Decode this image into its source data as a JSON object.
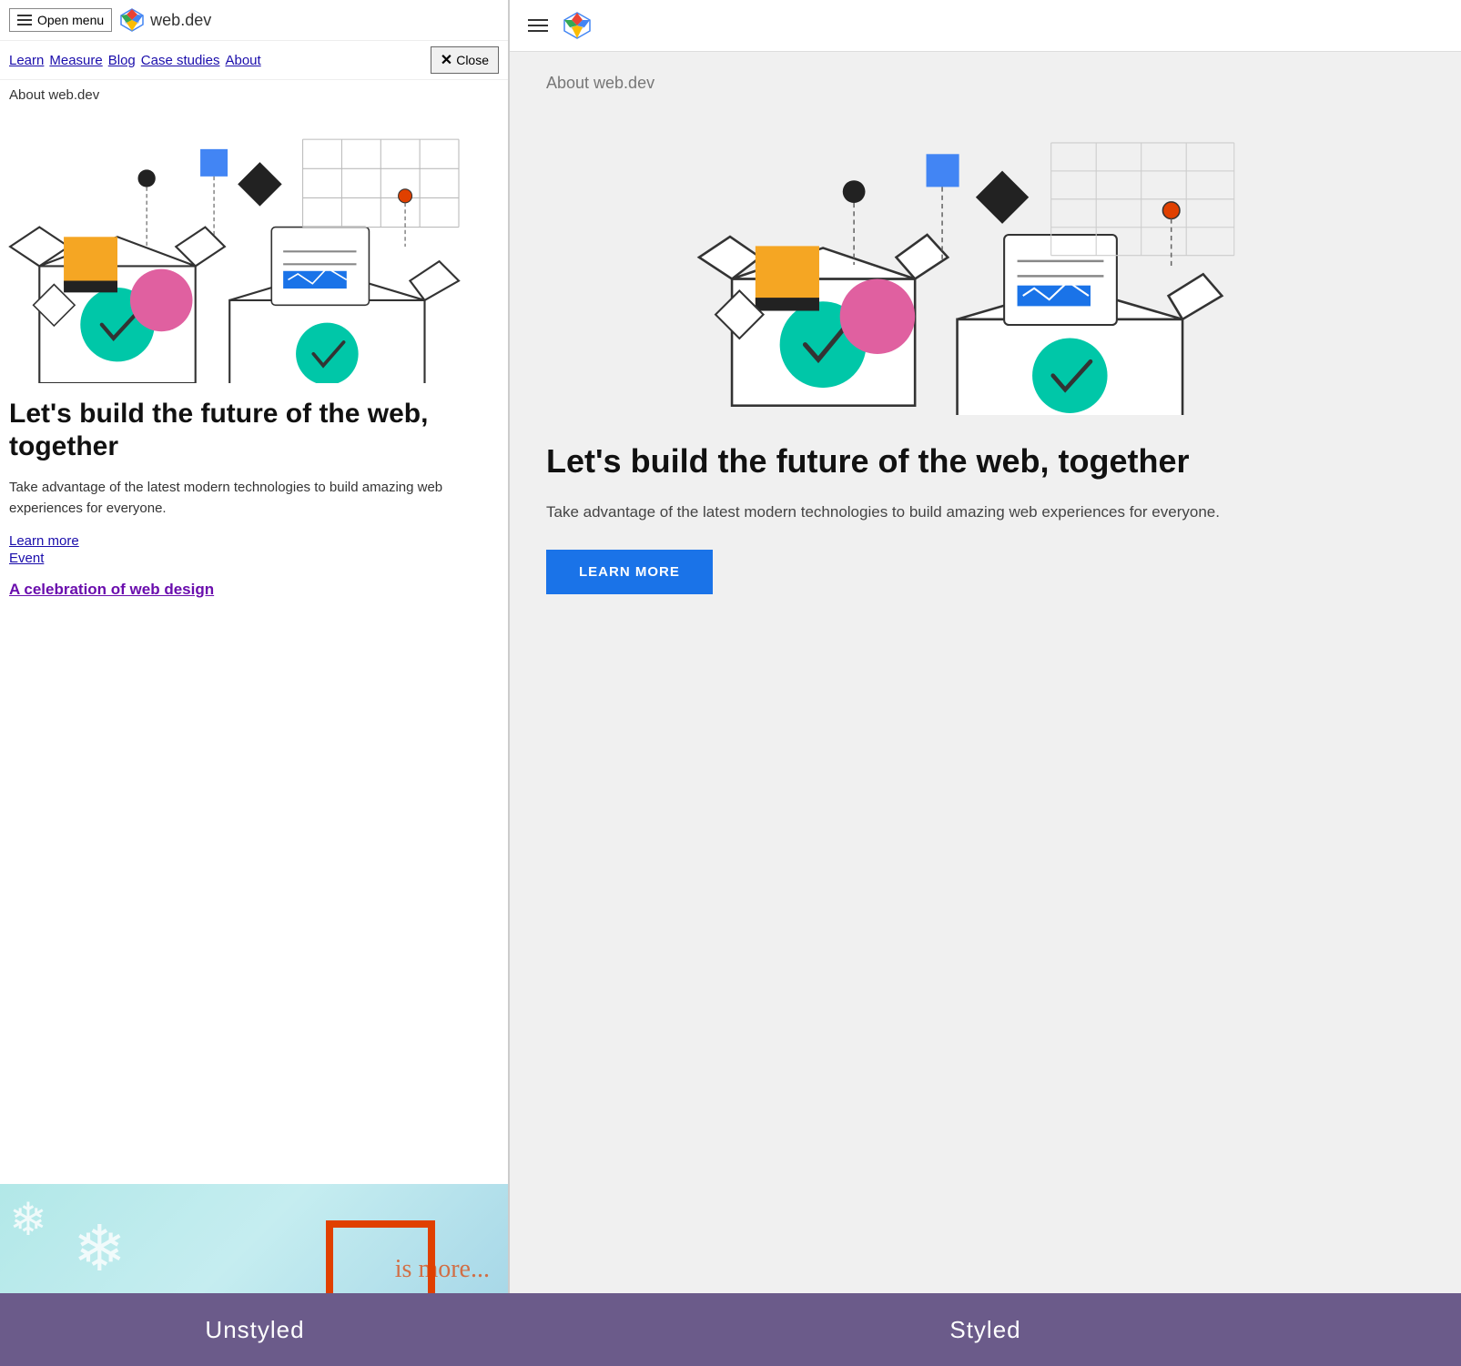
{
  "left": {
    "header": {
      "open_menu_label": "Open menu",
      "logo_text": "web.dev",
      "close_label": "Close"
    },
    "nav": {
      "links": [
        "Learn",
        "Measure",
        "Blog",
        "Case studies",
        "About"
      ]
    },
    "about_label": "About web.dev",
    "heading": "Let's build the future of the web, together",
    "description": "Take advantage of the latest modern technologies to build amazing web experiences for everyone.",
    "link_learn_more": "Learn more",
    "link_event": "Event",
    "link_celebration": "A celebration of web design"
  },
  "right": {
    "about_label": "About web.dev",
    "heading": "Let's build the future of the web, together",
    "description": "Take advantage of the latest modern technologies to build amazing web experiences for everyone.",
    "learn_more_btn": "LEARN MORE"
  },
  "bottom": {
    "unstyled_label": "Unstyled",
    "styled_label": "Styled"
  },
  "icons": {
    "hamburger": "☰",
    "close": "✕"
  }
}
